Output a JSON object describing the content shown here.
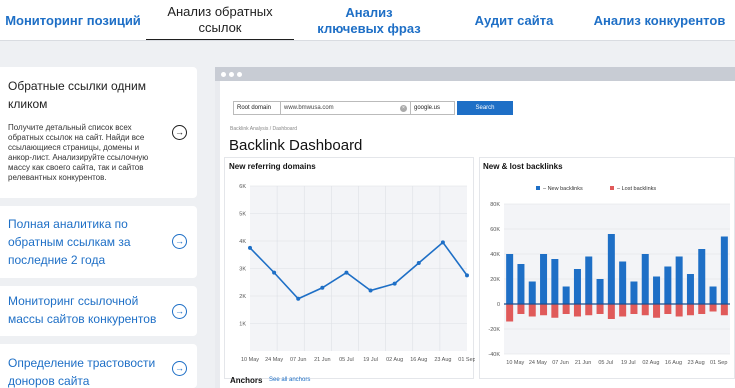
{
  "tabs": [
    {
      "label": "Мониторинг позиций"
    },
    {
      "label": "Анализ обратных ссылок"
    },
    {
      "label": "Анализ ключевых фраз"
    },
    {
      "label": "Аудит сайта"
    },
    {
      "label": "Анализ конкурентов"
    }
  ],
  "features": [
    {
      "title": "Обратные ссылки одним кликом",
      "desc": "Получите детальный список всех обратных ссылок на сайт. Найди все ссылающиеся страницы, домены и анкор-лист. Анализируйте ссылочную массу как своего сайта, так и сайтов релевантных конкурентов."
    },
    {
      "title": "Полная аналитика по обратным ссылкам за последние 2 года"
    },
    {
      "title": "Мониторинг ссылочной массы сайтов конкурентов"
    },
    {
      "title": "Определение трастовости доноров сайта"
    }
  ],
  "dashboard": {
    "search": {
      "domain_select": "Root domain",
      "url_value": "www.bmwusa.com",
      "engine_select": "google.us",
      "button": "Search"
    },
    "breadcrumb": "Backlink Analysis / Dashboard",
    "title": "Backlink Dashboard",
    "anchors_label": "Anchors",
    "anchors_link": "See all anchors"
  },
  "colors": {
    "accent": "#1e6fc6",
    "new_series": "#1e6fc6",
    "lost_series": "#e05a5a"
  },
  "chart_data": [
    {
      "type": "line",
      "title": "New referring domains",
      "categories": [
        "10 May",
        "24 May",
        "07 Jun",
        "21 Jun",
        "05 Jul",
        "19 Jul",
        "02 Aug",
        "16 Aug",
        "23 Aug",
        "01 Sep"
      ],
      "y_ticks": [
        "1K",
        "2K",
        "3K",
        "4K",
        "5K",
        "6K"
      ],
      "ylim": [
        0,
        6000
      ],
      "series": [
        {
          "values": [
            3750,
            2850,
            1900,
            2300,
            2850,
            2200,
            2450,
            3200,
            3950,
            2750
          ]
        }
      ],
      "grid": true
    },
    {
      "type": "bar",
      "title": "New & lost backlinks",
      "legend": "top",
      "categories": [
        "10 May",
        "24 May",
        "07 Jun",
        "21 Jun",
        "05 Jul",
        "19 Jul",
        "02 Aug",
        "16 Aug",
        "23 Aug",
        "01 Sep"
      ],
      "y_ticks": [
        "80K",
        "60K",
        "40K",
        "20K",
        "0",
        "-20K",
        "-40K"
      ],
      "ylim": [
        -40000,
        80000
      ],
      "series": [
        {
          "name": "New backlinks",
          "values": [
            40000,
            32000,
            18000,
            40000,
            36000,
            14000,
            28000,
            38000,
            20000,
            56000,
            34000,
            18000,
            40000,
            22000,
            30000,
            38000,
            24000,
            44000,
            14000,
            54000
          ]
        },
        {
          "name": "Lost backlinks",
          "values": [
            -14000,
            -8000,
            -10000,
            -9000,
            -11000,
            -8000,
            -10000,
            -9000,
            -8000,
            -12000,
            -10000,
            -8000,
            -9000,
            -11000,
            -8000,
            -10000,
            -9000,
            -8000,
            -6000,
            -9000
          ]
        }
      ],
      "grid": true
    }
  ]
}
